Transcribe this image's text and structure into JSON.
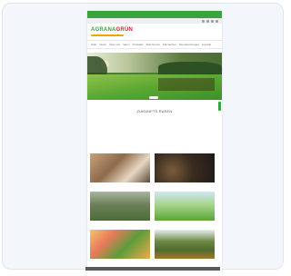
{
  "colors": {
    "brand_green": "#3aa33d",
    "brand_red": "#d9232d",
    "card_bg": "#f3f6fb"
  },
  "topbar": {
    "text": ""
  },
  "header": {
    "logo_main": "AGRANA",
    "logo_accent": "GRÜN"
  },
  "nav": {
    "items": [
      "Start",
      "News",
      "Über uns",
      "Ideen",
      "Produkte",
      "Referenzen",
      "Mitmachen",
      "Dienstleistungen",
      "Kontakt"
    ]
  },
  "hero": {
    "caption": ""
  },
  "intro": {
    "title": "ZUKUNFTS RASEN",
    "text": ""
  },
  "tiles": [
    {
      "label": ""
    },
    {
      "label": ""
    },
    {
      "label": ""
    },
    {
      "label": ""
    },
    {
      "label": ""
    },
    {
      "label": ""
    }
  ],
  "footer": {
    "text": ""
  }
}
